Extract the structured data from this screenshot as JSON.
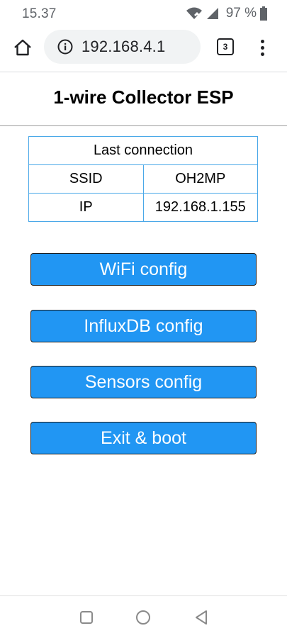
{
  "status": {
    "time": "15.37",
    "battery": "97 %",
    "icons": [
      "wifi-icon",
      "signal-icon",
      "battery-icon"
    ]
  },
  "browser": {
    "url": "192.168.4.1",
    "tab_count": "3",
    "icons": [
      "home-icon",
      "info-icon",
      "tab-switcher-icon",
      "overflow-menu-icon"
    ]
  },
  "page": {
    "title": "1-wire Collector ESP",
    "table": {
      "header": "Last connection",
      "rows": [
        {
          "key": "SSID",
          "value": "OH2MP"
        },
        {
          "key": "IP",
          "value": "192.168.1.155"
        }
      ]
    },
    "buttons": {
      "wifi": "WiFi config",
      "influx": "InfluxDB config",
      "sensors": "Sensors config",
      "exit": "Exit & boot"
    }
  },
  "nav": {
    "icons": [
      "recents-icon",
      "home-circle-icon",
      "back-icon"
    ]
  },
  "colors": {
    "button": "#2196f3",
    "table_border": "#4aa8e8"
  }
}
